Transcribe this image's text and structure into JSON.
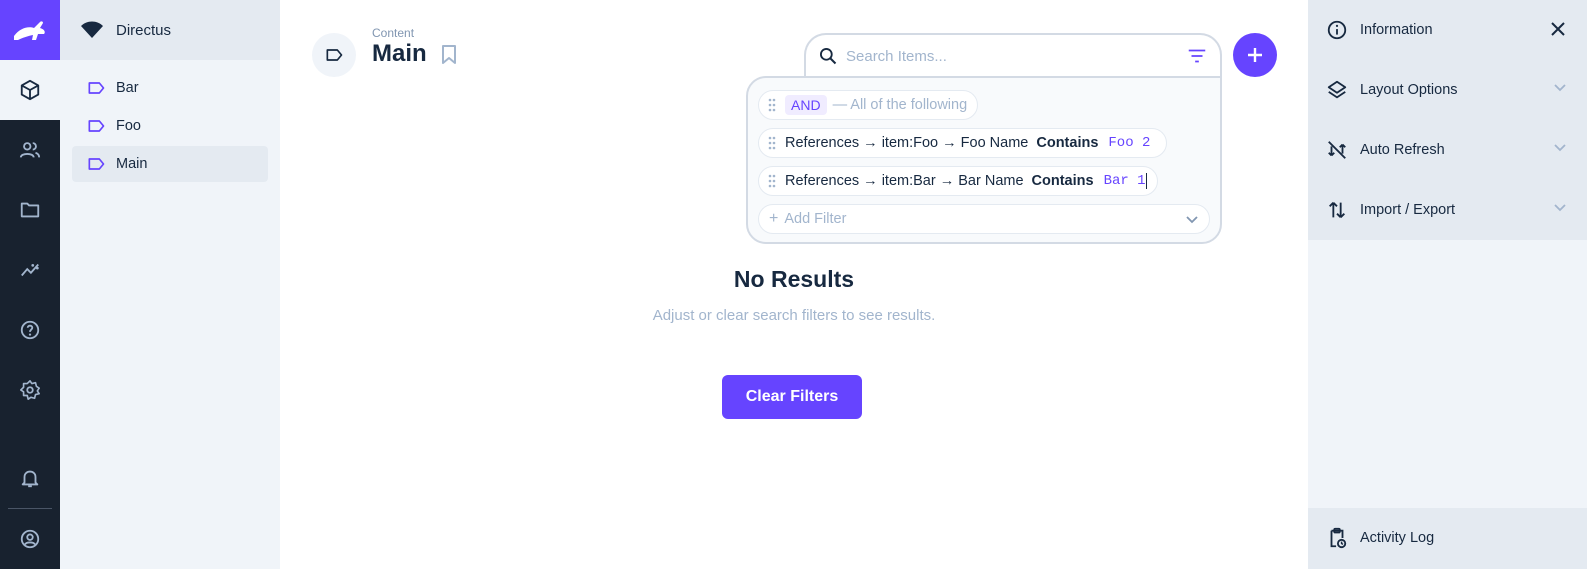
{
  "project": {
    "name": "Directus"
  },
  "navigation": {
    "items": [
      {
        "label": "Bar",
        "active": false
      },
      {
        "label": "Foo",
        "active": false
      },
      {
        "label": "Main",
        "active": true
      }
    ]
  },
  "header": {
    "breadcrumb": "Content",
    "title": "Main"
  },
  "search": {
    "placeholder": "Search Items..."
  },
  "filters": {
    "logic_label": "AND",
    "logic_description": "— All of the following",
    "rows": [
      {
        "field": "References → item:Foo → Foo Name",
        "operator": "Contains",
        "value": "Foo 2"
      },
      {
        "field": "References → item:Bar → Bar Name",
        "operator": "Contains",
        "value": "Bar 1"
      }
    ],
    "add_label": "Add Filter"
  },
  "empty_state": {
    "title": "No Results",
    "subtitle": "Adjust or clear search filters to see results.",
    "button": "Clear Filters"
  },
  "sidebar": {
    "information": "Information",
    "layout_options": "Layout Options",
    "auto_refresh": "Auto Refresh",
    "import_export": "Import / Export",
    "activity_log": "Activity Log"
  },
  "colors": {
    "accent": "#6644ff",
    "module_bar": "#18222f",
    "nav_bg": "#f0f4f9"
  },
  "icons": {
    "module_bar": [
      "box-icon",
      "users-icon",
      "folder-icon",
      "insights-icon",
      "help-icon",
      "settings-icon",
      "bell-icon",
      "account-icon"
    ]
  }
}
